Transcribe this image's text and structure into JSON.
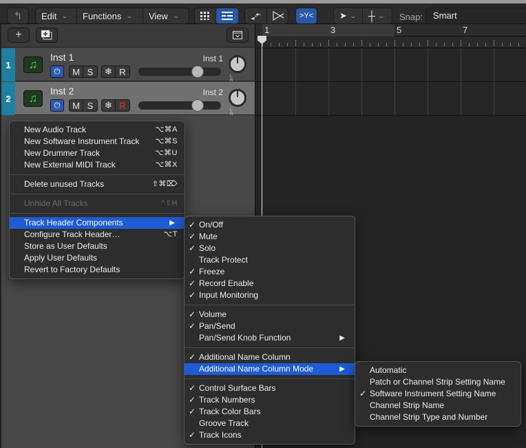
{
  "toolbar": {
    "back_icon": "back-arrow-icon",
    "menus": [
      {
        "label": "Edit"
      },
      {
        "label": "Functions"
      },
      {
        "label": "View"
      }
    ],
    "view_toggle": {
      "grid_icon": "grid-view-icon",
      "list_icon": "list-view-icon",
      "active": "list"
    },
    "automation_icon": "automation-curve-icon",
    "flex_icon": "flex-time-icon",
    "catch_icon": "catch-playhead-icon",
    "pointer_tool_icon": "pointer-tool-icon",
    "secondary_tool_icon": "crosshair-tool-icon",
    "snap_label": "Snap:",
    "snap_value": "Smart",
    "chevron": "⌄"
  },
  "track_list_header": {
    "add_track_icon": "plus-icon",
    "duplicate_track_icon": "duplicate-track-icon",
    "collapse_icon": "collapse-icon"
  },
  "tracks": [
    {
      "number": "1",
      "name": "Inst 1",
      "secondary_name": "Inst 1",
      "power": "⏻",
      "mute": "M",
      "solo": "S",
      "freeze": "❄",
      "record": "R",
      "record_armed": false,
      "volume_fraction": 0.72,
      "pan_lr": "L R"
    },
    {
      "number": "2",
      "name": "Inst 2",
      "secondary_name": "Inst 2",
      "power": "⏻",
      "mute": "M",
      "solo": "S",
      "freeze": "❄",
      "record": "R",
      "record_armed": true,
      "volume_fraction": 0.72,
      "pan_lr": "L R"
    }
  ],
  "ruler": {
    "bars": [
      "1",
      "3",
      "5",
      "7"
    ]
  },
  "context_menu": {
    "items": [
      {
        "label": "New Audio Track",
        "shortcut": "⌥⌘A"
      },
      {
        "label": "New Software Instrument Track",
        "shortcut": "⌥⌘S"
      },
      {
        "label": "New Drummer Track",
        "shortcut": "⌥⌘U"
      },
      {
        "label": "New External MIDI Track",
        "shortcut": "⌥⌘X"
      },
      {
        "label": "Delete unused Tracks",
        "shortcut": "⇧⌘⌦"
      },
      {
        "label": "Unhide All Tracks",
        "shortcut": "^⇧H",
        "disabled": true
      },
      {
        "label": "Track Header Components",
        "submenu": true,
        "highlighted": true
      },
      {
        "label": "Configure Track Header…",
        "shortcut": "⌥T"
      },
      {
        "label": "Store as User Defaults"
      },
      {
        "label": "Apply User Defaults"
      },
      {
        "label": "Revert to Factory Defaults"
      }
    ],
    "submenu_arrow": "▶"
  },
  "components_menu": {
    "items": [
      {
        "label": "On/Off",
        "checked": true
      },
      {
        "label": "Mute",
        "checked": true
      },
      {
        "label": "Solo",
        "checked": true
      },
      {
        "label": "Track Protect",
        "checked": false
      },
      {
        "label": "Freeze",
        "checked": true
      },
      {
        "label": "Record Enable",
        "checked": true
      },
      {
        "label": "Input Monitoring",
        "checked": true
      },
      {
        "label": "Volume",
        "checked": true
      },
      {
        "label": "Pan/Send",
        "checked": true
      },
      {
        "label": "Pan/Send Knob Function",
        "checked": false,
        "submenu": true
      },
      {
        "label": "Additional Name Column",
        "checked": true
      },
      {
        "label": "Additional Name Column Mode",
        "checked": false,
        "submenu": true,
        "highlighted": true
      },
      {
        "label": "Control Surface Bars",
        "checked": true
      },
      {
        "label": "Track Numbers",
        "checked": true
      },
      {
        "label": "Track Color Bars",
        "checked": true
      },
      {
        "label": "Groove Track",
        "checked": false
      },
      {
        "label": "Track Icons",
        "checked": true
      }
    ],
    "check_glyph": "✓",
    "submenu_arrow": "▶"
  },
  "name_mode_menu": {
    "items": [
      {
        "label": "Automatic",
        "checked": false
      },
      {
        "label": "Patch or Channel Strip Setting Name",
        "checked": false
      },
      {
        "label": "Software Instrument Setting Name",
        "checked": true
      },
      {
        "label": "Channel Strip Name",
        "checked": false
      },
      {
        "label": "Channel Strip Type and Number",
        "checked": false
      }
    ],
    "check_glyph": "✓"
  },
  "colors": {
    "accent_blue": "#1d5cd6",
    "track_number_blue": "#1f7fa0",
    "record_red": "#e53030",
    "instrument_green": "#3ed24a"
  }
}
